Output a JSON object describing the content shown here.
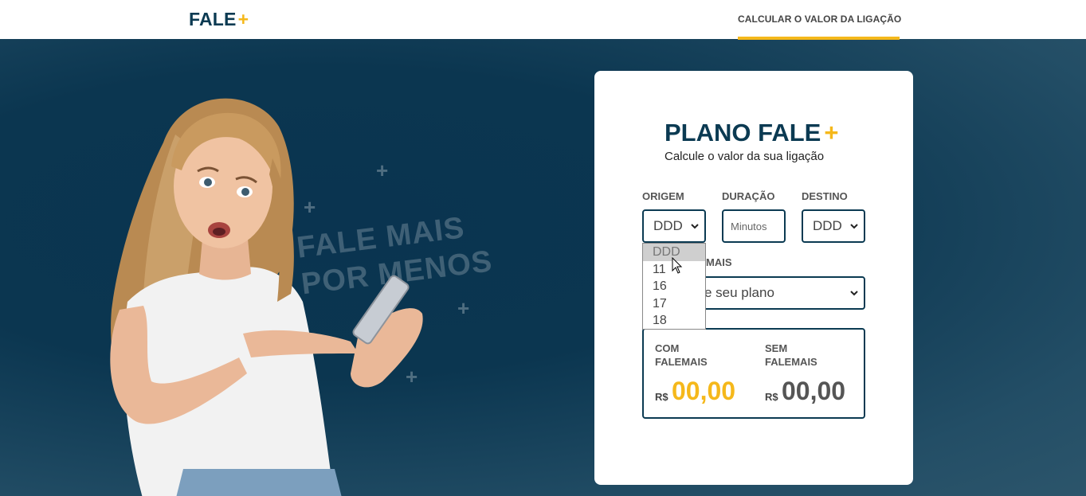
{
  "header": {
    "logo_text": "FALE",
    "logo_plus": "+",
    "nav_link": "CALCULAR O VALOR DA LIGAÇÃO"
  },
  "hero": {
    "slogan_line1": "FALE MAIS",
    "slogan_line2": "POR MENOS"
  },
  "card": {
    "title": "PLANO FALE",
    "title_plus": "+",
    "subtitle": "Calcule o valor da sua ligação",
    "origin": {
      "label": "ORIGEM",
      "value": "DDD"
    },
    "duration": {
      "label": "DURAÇÃO",
      "placeholder": "Minutos"
    },
    "destination": {
      "label": "DESTINO",
      "value": "DDD"
    },
    "plan": {
      "label": "MAIS",
      "value": "e seu plano"
    },
    "origin_options": [
      "DDD",
      "11",
      "16",
      "17",
      "18"
    ],
    "with_plan": {
      "label": "COM FALEMAIS",
      "currency": "R$",
      "value": "00,00"
    },
    "without_plan": {
      "label": "SEM FALEMAIS",
      "currency": "R$",
      "value": "00,00"
    }
  },
  "colors": {
    "primary": "#0b3a52",
    "accent": "#f5b81b"
  }
}
